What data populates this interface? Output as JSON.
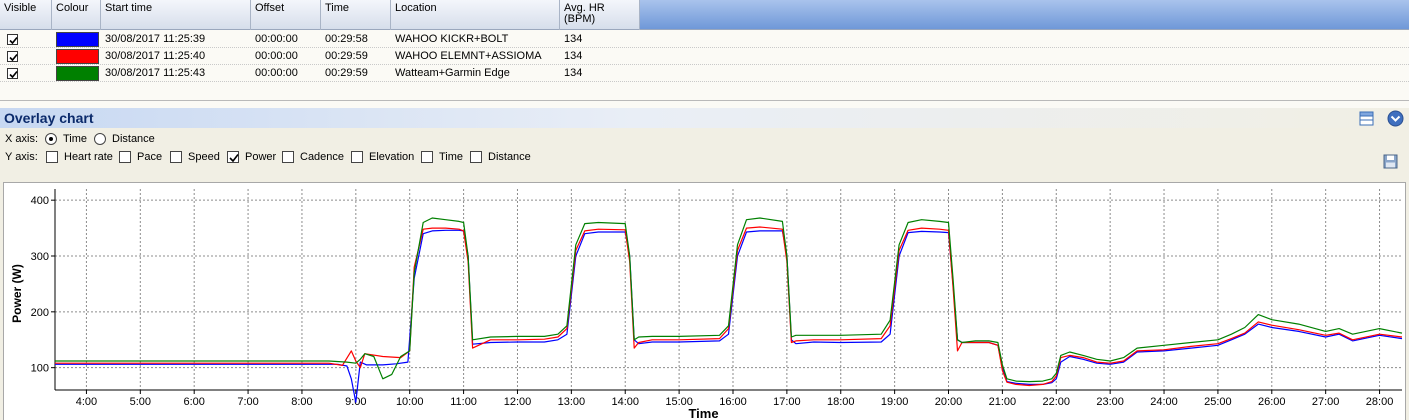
{
  "table": {
    "headers": [
      "Visible",
      "Colour",
      "Start time",
      "Offset",
      "Time",
      "Location",
      "Avg. HR (BPM)"
    ],
    "rows": [
      {
        "visible": true,
        "colour": "#0000ff",
        "start_time": "30/08/2017 11:25:39",
        "offset": "00:00:00",
        "time": "00:29:58",
        "location": "WAHOO KICKR+BOLT",
        "avg_hr": "134"
      },
      {
        "visible": true,
        "colour": "#ff0000",
        "start_time": "30/08/2017 11:25:40",
        "offset": "00:00:00",
        "time": "00:29:59",
        "location": "WAHOO ELEMNT+ASSIOMA",
        "avg_hr": "134"
      },
      {
        "visible": true,
        "colour": "#008000",
        "start_time": "30/08/2017 11:25:43",
        "offset": "00:00:00",
        "time": "00:29:59",
        "location": "Watteam+Garmin Edge",
        "avg_hr": "134"
      }
    ]
  },
  "panel": {
    "title": "Overlay chart",
    "x_axis_label": "X axis:",
    "x_options": [
      {
        "label": "Time",
        "selected": true
      },
      {
        "label": "Distance",
        "selected": false
      }
    ],
    "y_axis_label": "Y axis:",
    "y_options": [
      {
        "label": "Heart rate",
        "checked": false
      },
      {
        "label": "Pace",
        "checked": false
      },
      {
        "label": "Speed",
        "checked": false
      },
      {
        "label": "Power",
        "checked": true
      },
      {
        "label": "Cadence",
        "checked": false
      },
      {
        "label": "Elevation",
        "checked": false
      },
      {
        "label": "Time",
        "checked": false
      },
      {
        "label": "Distance",
        "checked": false
      }
    ]
  },
  "chart_data": {
    "type": "line",
    "xlabel": "Time",
    "ylabel": "Power (W)",
    "xlim": [
      "3:25",
      "28:25"
    ],
    "ylim": [
      60,
      420
    ],
    "x_ticks": [
      "4:00",
      "5:00",
      "6:00",
      "7:00",
      "8:00",
      "9:00",
      "10:00",
      "11:00",
      "12:00",
      "13:00",
      "14:00",
      "15:00",
      "16:00",
      "17:00",
      "18:00",
      "19:00",
      "20:00",
      "21:00",
      "22:00",
      "23:00",
      "24:00",
      "25:00",
      "26:00",
      "27:00",
      "28:00"
    ],
    "y_ticks": [
      100,
      200,
      300,
      400
    ],
    "grid": true,
    "legend": "none",
    "series": [
      {
        "color": "#0000ff",
        "x": [
          "3:25",
          "8:40",
          "8:50",
          "8:55",
          "9:00",
          "9:05",
          "9:12",
          "9:30",
          "9:45",
          "9:58",
          "10:05",
          "10:15",
          "10:25",
          "10:40",
          "10:55",
          "11:00",
          "11:05",
          "11:10",
          "11:30",
          "12:00",
          "12:30",
          "12:45",
          "12:55",
          "13:05",
          "13:15",
          "13:30",
          "14:00",
          "14:05",
          "14:10",
          "14:15",
          "14:30",
          "15:00",
          "15:45",
          "15:55",
          "16:05",
          "16:15",
          "16:30",
          "16:55",
          "17:00",
          "17:05",
          "17:10",
          "17:30",
          "18:00",
          "18:45",
          "18:55",
          "19:05",
          "19:15",
          "19:30",
          "19:50",
          "20:00",
          "20:05",
          "20:10",
          "20:15",
          "20:30",
          "20:45",
          "20:55",
          "21:00",
          "21:05",
          "21:15",
          "21:30",
          "21:45",
          "21:55",
          "22:00",
          "22:05",
          "22:15",
          "22:30",
          "22:45",
          "23:00",
          "23:15",
          "23:30",
          "24:00",
          "24:30",
          "25:00",
          "25:15",
          "25:30",
          "25:45",
          "26:00",
          "26:30",
          "27:00",
          "27:15",
          "27:30",
          "28:00",
          "28:25"
        ],
        "y": [
          106,
          106,
          103,
          80,
          38,
          110,
          105,
          105,
          107,
          110,
          260,
          340,
          345,
          346,
          346,
          345,
          300,
          142,
          145,
          146,
          146,
          150,
          160,
          300,
          340,
          343,
          343,
          300,
          150,
          143,
          146,
          146,
          148,
          160,
          300,
          343,
          345,
          345,
          300,
          150,
          143,
          146,
          145,
          146,
          160,
          300,
          342,
          344,
          343,
          342,
          250,
          150,
          145,
          145,
          145,
          140,
          100,
          75,
          72,
          70,
          70,
          73,
          80,
          110,
          120,
          115,
          108,
          106,
          110,
          128,
          130,
          135,
          140,
          150,
          160,
          178,
          172,
          165,
          155,
          160,
          148,
          158,
          152
        ]
      },
      {
        "color": "#ff0000",
        "x": [
          "3:25",
          "8:30",
          "8:45",
          "8:55",
          "9:00",
          "9:05",
          "9:10",
          "9:30",
          "9:50",
          "10:00",
          "10:05",
          "10:15",
          "10:25",
          "10:40",
          "10:55",
          "11:00",
          "11:05",
          "11:10",
          "11:30",
          "12:00",
          "12:30",
          "12:45",
          "12:55",
          "13:05",
          "13:15",
          "13:30",
          "14:00",
          "14:05",
          "14:10",
          "14:15",
          "14:30",
          "15:00",
          "15:45",
          "15:55",
          "16:05",
          "16:15",
          "16:30",
          "16:55",
          "17:00",
          "17:05",
          "17:10",
          "17:30",
          "18:00",
          "18:45",
          "18:55",
          "19:05",
          "19:15",
          "19:30",
          "19:50",
          "20:00",
          "20:05",
          "20:10",
          "20:15",
          "20:30",
          "20:45",
          "20:55",
          "21:00",
          "21:05",
          "21:15",
          "21:30",
          "21:45",
          "21:55",
          "22:00",
          "22:05",
          "22:15",
          "22:30",
          "22:45",
          "23:00",
          "23:15",
          "23:30",
          "24:00",
          "24:30",
          "25:00",
          "25:15",
          "25:30",
          "25:45",
          "26:00",
          "26:30",
          "27:00",
          "27:15",
          "27:30",
          "28:00",
          "28:25"
        ],
        "y": [
          108,
          108,
          104,
          130,
          112,
          100,
          125,
          120,
          118,
          130,
          280,
          348,
          350,
          350,
          348,
          345,
          290,
          135,
          150,
          150,
          151,
          155,
          170,
          310,
          345,
          348,
          347,
          290,
          135,
          145,
          150,
          150,
          152,
          170,
          310,
          350,
          352,
          348,
          290,
          145,
          148,
          150,
          150,
          152,
          175,
          310,
          346,
          350,
          348,
          346,
          245,
          130,
          145,
          145,
          145,
          140,
          95,
          74,
          70,
          68,
          70,
          75,
          85,
          118,
          122,
          118,
          110,
          108,
          112,
          130,
          132,
          138,
          143,
          152,
          162,
          182,
          176,
          168,
          158,
          162,
          150,
          160,
          155
        ]
      },
      {
        "color": "#008000",
        "x": [
          "3:25",
          "8:30",
          "8:50",
          "9:00",
          "9:05",
          "9:10",
          "9:20",
          "9:30",
          "9:40",
          "9:50",
          "10:00",
          "10:05",
          "10:15",
          "10:25",
          "10:40",
          "10:55",
          "11:00",
          "11:05",
          "11:10",
          "11:30",
          "12:00",
          "12:30",
          "12:45",
          "12:55",
          "13:05",
          "13:15",
          "13:30",
          "14:00",
          "14:05",
          "14:10",
          "14:15",
          "14:30",
          "15:00",
          "15:45",
          "15:55",
          "16:05",
          "16:15",
          "16:30",
          "16:55",
          "17:00",
          "17:05",
          "17:10",
          "17:30",
          "18:00",
          "18:45",
          "18:55",
          "19:05",
          "19:15",
          "19:30",
          "19:50",
          "20:00",
          "20:05",
          "20:10",
          "20:15",
          "20:30",
          "20:45",
          "20:55",
          "21:00",
          "21:05",
          "21:15",
          "21:30",
          "21:45",
          "21:55",
          "22:00",
          "22:05",
          "22:15",
          "22:30",
          "22:45",
          "23:00",
          "23:15",
          "23:30",
          "24:00",
          "24:30",
          "25:00",
          "25:15",
          "25:30",
          "25:45",
          "26:00",
          "26:30",
          "27:00",
          "27:15",
          "27:30",
          "28:00",
          "28:25"
        ],
        "y": [
          112,
          112,
          110,
          108,
          115,
          125,
          120,
          80,
          88,
          120,
          130,
          270,
          360,
          368,
          365,
          362,
          360,
          300,
          150,
          155,
          156,
          156,
          160,
          175,
          320,
          358,
          360,
          358,
          300,
          150,
          155,
          156,
          156,
          158,
          175,
          320,
          365,
          368,
          362,
          300,
          155,
          158,
          158,
          158,
          160,
          185,
          320,
          360,
          365,
          362,
          360,
          260,
          150,
          145,
          148,
          148,
          145,
          105,
          80,
          76,
          75,
          76,
          80,
          90,
          122,
          128,
          122,
          115,
          112,
          118,
          135,
          140,
          145,
          150,
          160,
          172,
          195,
          186,
          178,
          165,
          170,
          160,
          170,
          162
        ]
      }
    ]
  }
}
